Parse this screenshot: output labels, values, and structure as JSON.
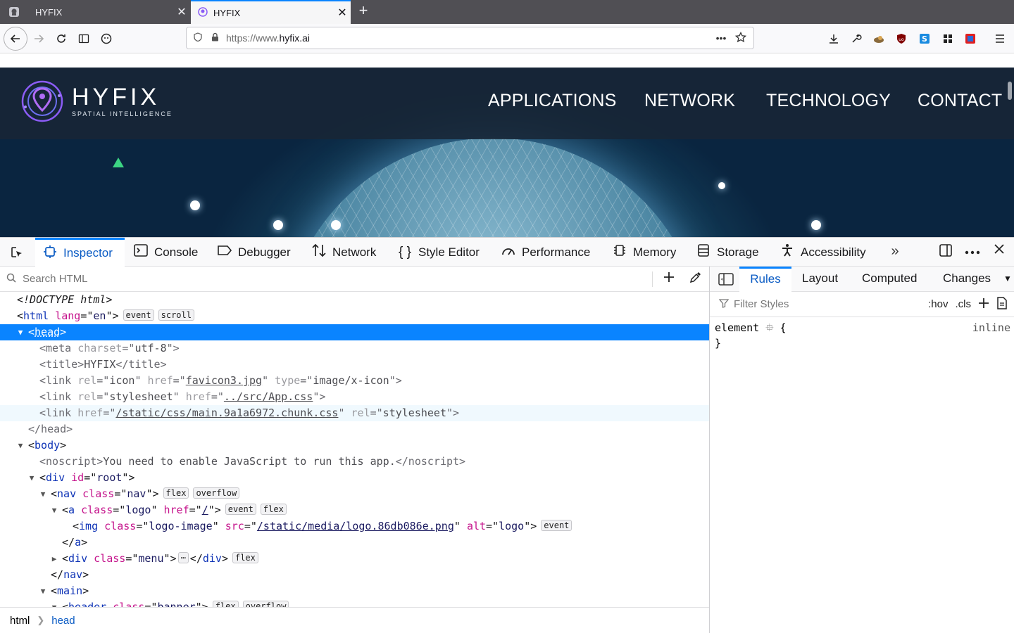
{
  "browser": {
    "tabs": [
      {
        "label": "HYFIX",
        "close": "✕"
      },
      {
        "label": "HYFIX",
        "close": "✕"
      }
    ],
    "new_tab": "+",
    "url_prefix": "https://www.",
    "url_domain": "hyfix.ai",
    "url_menu": "•••"
  },
  "site": {
    "brand": "HYFIX",
    "tagline": "SPATIAL INTELLIGENCE",
    "menu": [
      "APPLICATIONS",
      "NETWORK",
      "TECHNOLOGY",
      "CONTACT"
    ]
  },
  "devtools": {
    "tabs": [
      {
        "label": "Inspector"
      },
      {
        "label": "Console"
      },
      {
        "label": "Debugger"
      },
      {
        "label": "Network"
      },
      {
        "label": "Style Editor"
      },
      {
        "label": "Performance"
      },
      {
        "label": "Memory"
      },
      {
        "label": "Storage"
      },
      {
        "label": "Accessibility"
      }
    ],
    "search_placeholder": "Search HTML",
    "breadcrumbs": [
      "html",
      "head"
    ],
    "side_tabs": [
      "Rules",
      "Layout",
      "Computed",
      "Changes"
    ],
    "filter_placeholder": "Filter Styles",
    "hov": ":hov",
    "cls": ".cls",
    "rule_selector": "element",
    "rule_open": "{",
    "rule_close": "}",
    "rule_source": "inline"
  },
  "markup": {
    "doctype": "<!DOCTYPE html>",
    "html_lang": "en",
    "badges": {
      "event": "event",
      "scroll": "scroll",
      "flex": "flex",
      "overflow": "overflow"
    },
    "meta_charset": "utf-8",
    "title_text": "HYFIX",
    "link1_href": "favicon3.jpg",
    "link1_type": "image/x-icon",
    "link2_href": "../src/App.css",
    "link3_href": "/static/css/main.9a1a6972.chunk.css",
    "noscript_text": "You need to enable JavaScript to run this app.",
    "root_id": "root",
    "nav_class": "nav",
    "logo_class": "logo",
    "logo_href": "/",
    "img_class": "logo-image",
    "img_src": "/static/media/logo.86db086e.png",
    "img_alt": "logo",
    "menu_class": "menu",
    "header_class": "banner"
  },
  "colors": {
    "accent": "#0a84ff",
    "selected_row": "#0a84ff",
    "tag": "#0e33b6",
    "attr_name": "#c5148c"
  }
}
